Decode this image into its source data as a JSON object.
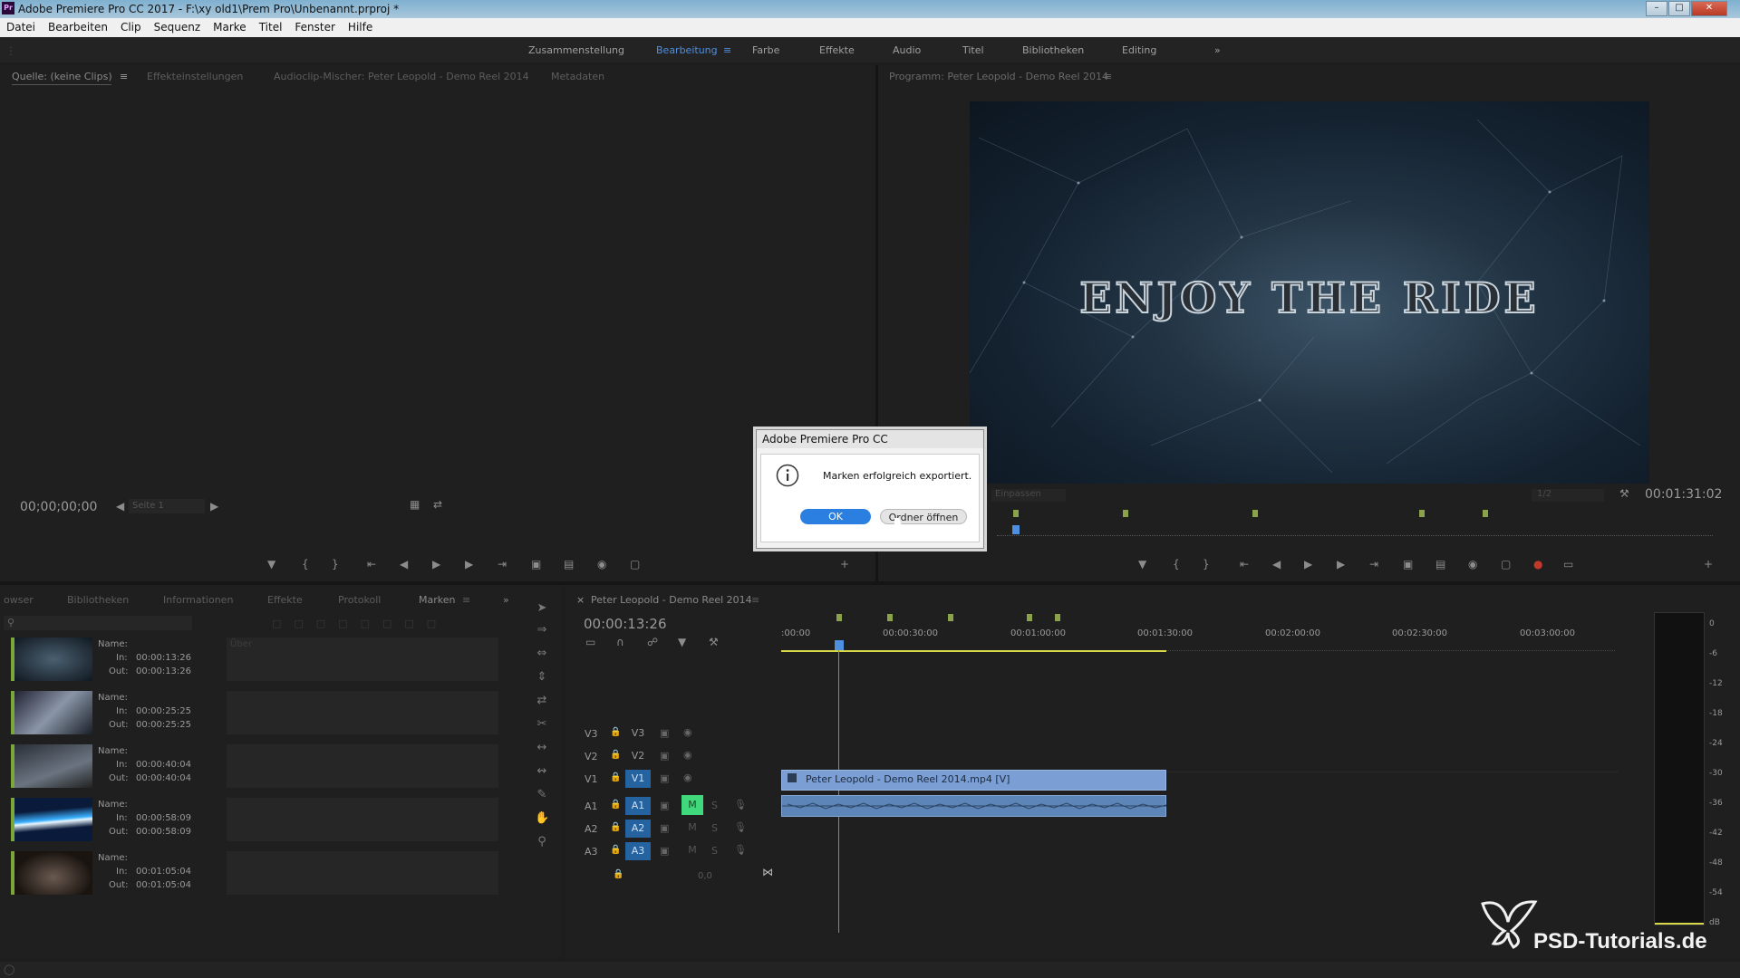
{
  "window": {
    "title": "Adobe Premiere Pro CC 2017 - F:\\xy old1\\Prem Pro\\Unbenannt.prproj *",
    "app_icon": "Pr",
    "controls": [
      "minimize-icon",
      "maximize-icon",
      "close-icon"
    ]
  },
  "menu": [
    "Datei",
    "Bearbeiten",
    "Clip",
    "Sequenz",
    "Marke",
    "Titel",
    "Fenster",
    "Hilfe"
  ],
  "workspaces": {
    "items": [
      "Zusammenstellung",
      "Bearbeitung",
      "Farbe",
      "Effekte",
      "Audio",
      "Titel",
      "Bibliotheken",
      "Editing"
    ],
    "active": "Bearbeitung",
    "more": "»"
  },
  "source_panel": {
    "tabs": [
      "Quelle: (keine Clips)",
      "Effekteinstellungen",
      "Audioclip-Mischer: Peter Leopold - Demo Reel 2014",
      "Metadaten"
    ],
    "timecode": "00;00;00;00",
    "page_select": "Seite 1"
  },
  "program_panel": {
    "title": "Programm: Peter Leopold - Demo Reel 2014",
    "video_text": "ENJOY THE RIDE",
    "fit": "Einpassen",
    "ratio": "1/2",
    "duration": "00:01:31:02"
  },
  "dialog": {
    "title": "Adobe Premiere Pro CC",
    "message": "Marken erfolgreich exportiert.",
    "ok_label": "OK",
    "open_folder_label": "Ordner öffnen",
    "accent": "#2a7fe0"
  },
  "markers_panel": {
    "tabs": [
      "owser",
      "Bibliotheken",
      "Informationen",
      "Effekte",
      "Protokoll",
      "Marken"
    ],
    "active_tab": "Marken",
    "comment_placeholder": "Über",
    "name_label": "Name:",
    "in_label": "In:",
    "out_label": "Out:",
    "rows": [
      {
        "in": "00:00:13:26",
        "out": "00:00:13:26"
      },
      {
        "in": "00:00:25:25",
        "out": "00:00:25:25"
      },
      {
        "in": "00:00:40:04",
        "out": "00:00:40:04"
      },
      {
        "in": "00:00:58:09",
        "out": "00:00:58:09"
      },
      {
        "in": "00:01:05:04",
        "out": "00:01:05:04"
      }
    ]
  },
  "timeline": {
    "sequence_tab": "Peter Leopold - Demo Reel 2014",
    "timecode": "00:00:13:26",
    "ruler": [
      ":00:00",
      "00:00:30:00",
      "00:01:00:00",
      "00:01:30:00",
      "00:02:00:00",
      "00:02:30:00",
      "00:03:00:00"
    ],
    "video_tracks": [
      {
        "label": "V3",
        "target": "V3"
      },
      {
        "label": "V2",
        "target": "V2"
      },
      {
        "label": "V1",
        "target": "V1"
      }
    ],
    "audio_tracks": [
      {
        "label": "A1",
        "target": "A1"
      },
      {
        "label": "A2",
        "target": "A2"
      },
      {
        "label": "A3",
        "target": "A3"
      }
    ],
    "master_value": "0,0",
    "clip_name": "Peter Leopold - Demo Reel 2014.mp4 [V]"
  },
  "audio_meter": {
    "scale": [
      "0",
      "-6",
      "-12",
      "-18",
      "-24",
      "-30",
      "-36",
      "-42",
      "-48",
      "-54",
      "dB"
    ]
  },
  "watermark": "PSD-Tutorials.de"
}
